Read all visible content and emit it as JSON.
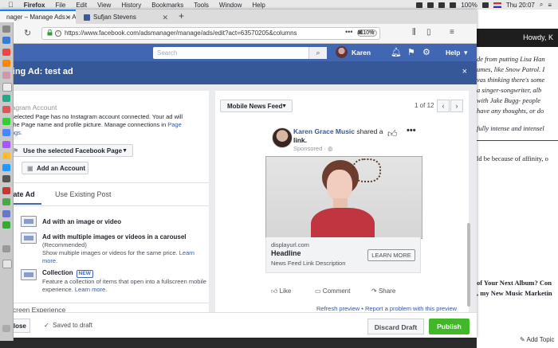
{
  "menubar": {
    "apple": "",
    "items": [
      "Firefox",
      "File",
      "Edit",
      "View",
      "History",
      "Bookmarks",
      "Tools",
      "Window",
      "Help"
    ],
    "battery": "100%",
    "clock": "Thu 20:07"
  },
  "browser": {
    "tabs": [
      {
        "label": "nager – Manage Ads – A"
      },
      {
        "label": "Sufjan Stevens"
      }
    ],
    "new_tab": "+",
    "url": "https://www.facebook.com/adsmanager/manage/ads/edit?act=63570205&columns",
    "zoom": "110%"
  },
  "fb_header": {
    "search_placeholder": "Search",
    "user_name": "Karen",
    "help": "Help"
  },
  "editor": {
    "title": "ating Ad: test ad",
    "close": "×"
  },
  "left_panel": {
    "instagram_heading": "stagram Account",
    "instagram_text_1": "e selected Page has no Instagram account connected. Your ad will",
    "instagram_text_2": "e the Page name and profile picture. Manage connections in",
    "instagram_link_1": "Page",
    "instagram_link_2": "ttings.",
    "use_page_button": "Use the selected Facebook Page",
    "or_label": "R",
    "add_account_button": "Add an Account",
    "tabs": {
      "create": "reate Ad",
      "existing": "Use Existing Post"
    },
    "formats": [
      {
        "title": "Ad with an image or video",
        "sub": "",
        "desc": "",
        "link": ""
      },
      {
        "title": "Ad with multiple images or videos in a carousel",
        "sub": "(Recommended)",
        "desc": "Show multiple images or videos for the same price.",
        "link": "Learn",
        "link2": "more."
      },
      {
        "title": "Collection",
        "badge": "NEW",
        "desc": "Feature a collection of items that open into a fullscreen mobile",
        "desc2": "experience.",
        "link": "Learn more."
      }
    ],
    "fullscreen_label": "llscreen Experience"
  },
  "preview": {
    "placement": "Mobile News Feed",
    "pager": "1 of 12",
    "page_name": "Karen Grace Music",
    "shared_text": "shared a",
    "shared_link": "link.",
    "sponsored": "Sponsored ·",
    "display_url": "displayurl.com",
    "headline": "Headline",
    "link_description": "News Feed Link Description",
    "cta": "LEARN MORE",
    "reactions": {
      "like": "Like",
      "comment": "Comment",
      "share": "Share"
    },
    "refresh": "Refresh preview",
    "report": "Report a problem with this preview"
  },
  "footer": {
    "close": "Close",
    "saved": "Saved to draft",
    "discard": "Discard Draft",
    "publish": "Publish"
  },
  "background_doc": {
    "user": "Howdy, K",
    "lines": [
      "de from putting Lisa Han",
      "umes, like Snow Patrol. I",
      "vas thinking there's some",
      "a singer-songwriter, alb",
      "with Jake Bugg- people",
      "have any thoughts, or do",
      "fully intense and intensel",
      "ld be because of affinity, o",
      "of Your Next Album? Con",
      ", my New Music Marketin"
    ],
    "add_topic": "Add Topic"
  },
  "colors": {
    "fb_blue": "#4267b2",
    "publish_green": "#42b72a",
    "editor_bar": "#365899"
  }
}
